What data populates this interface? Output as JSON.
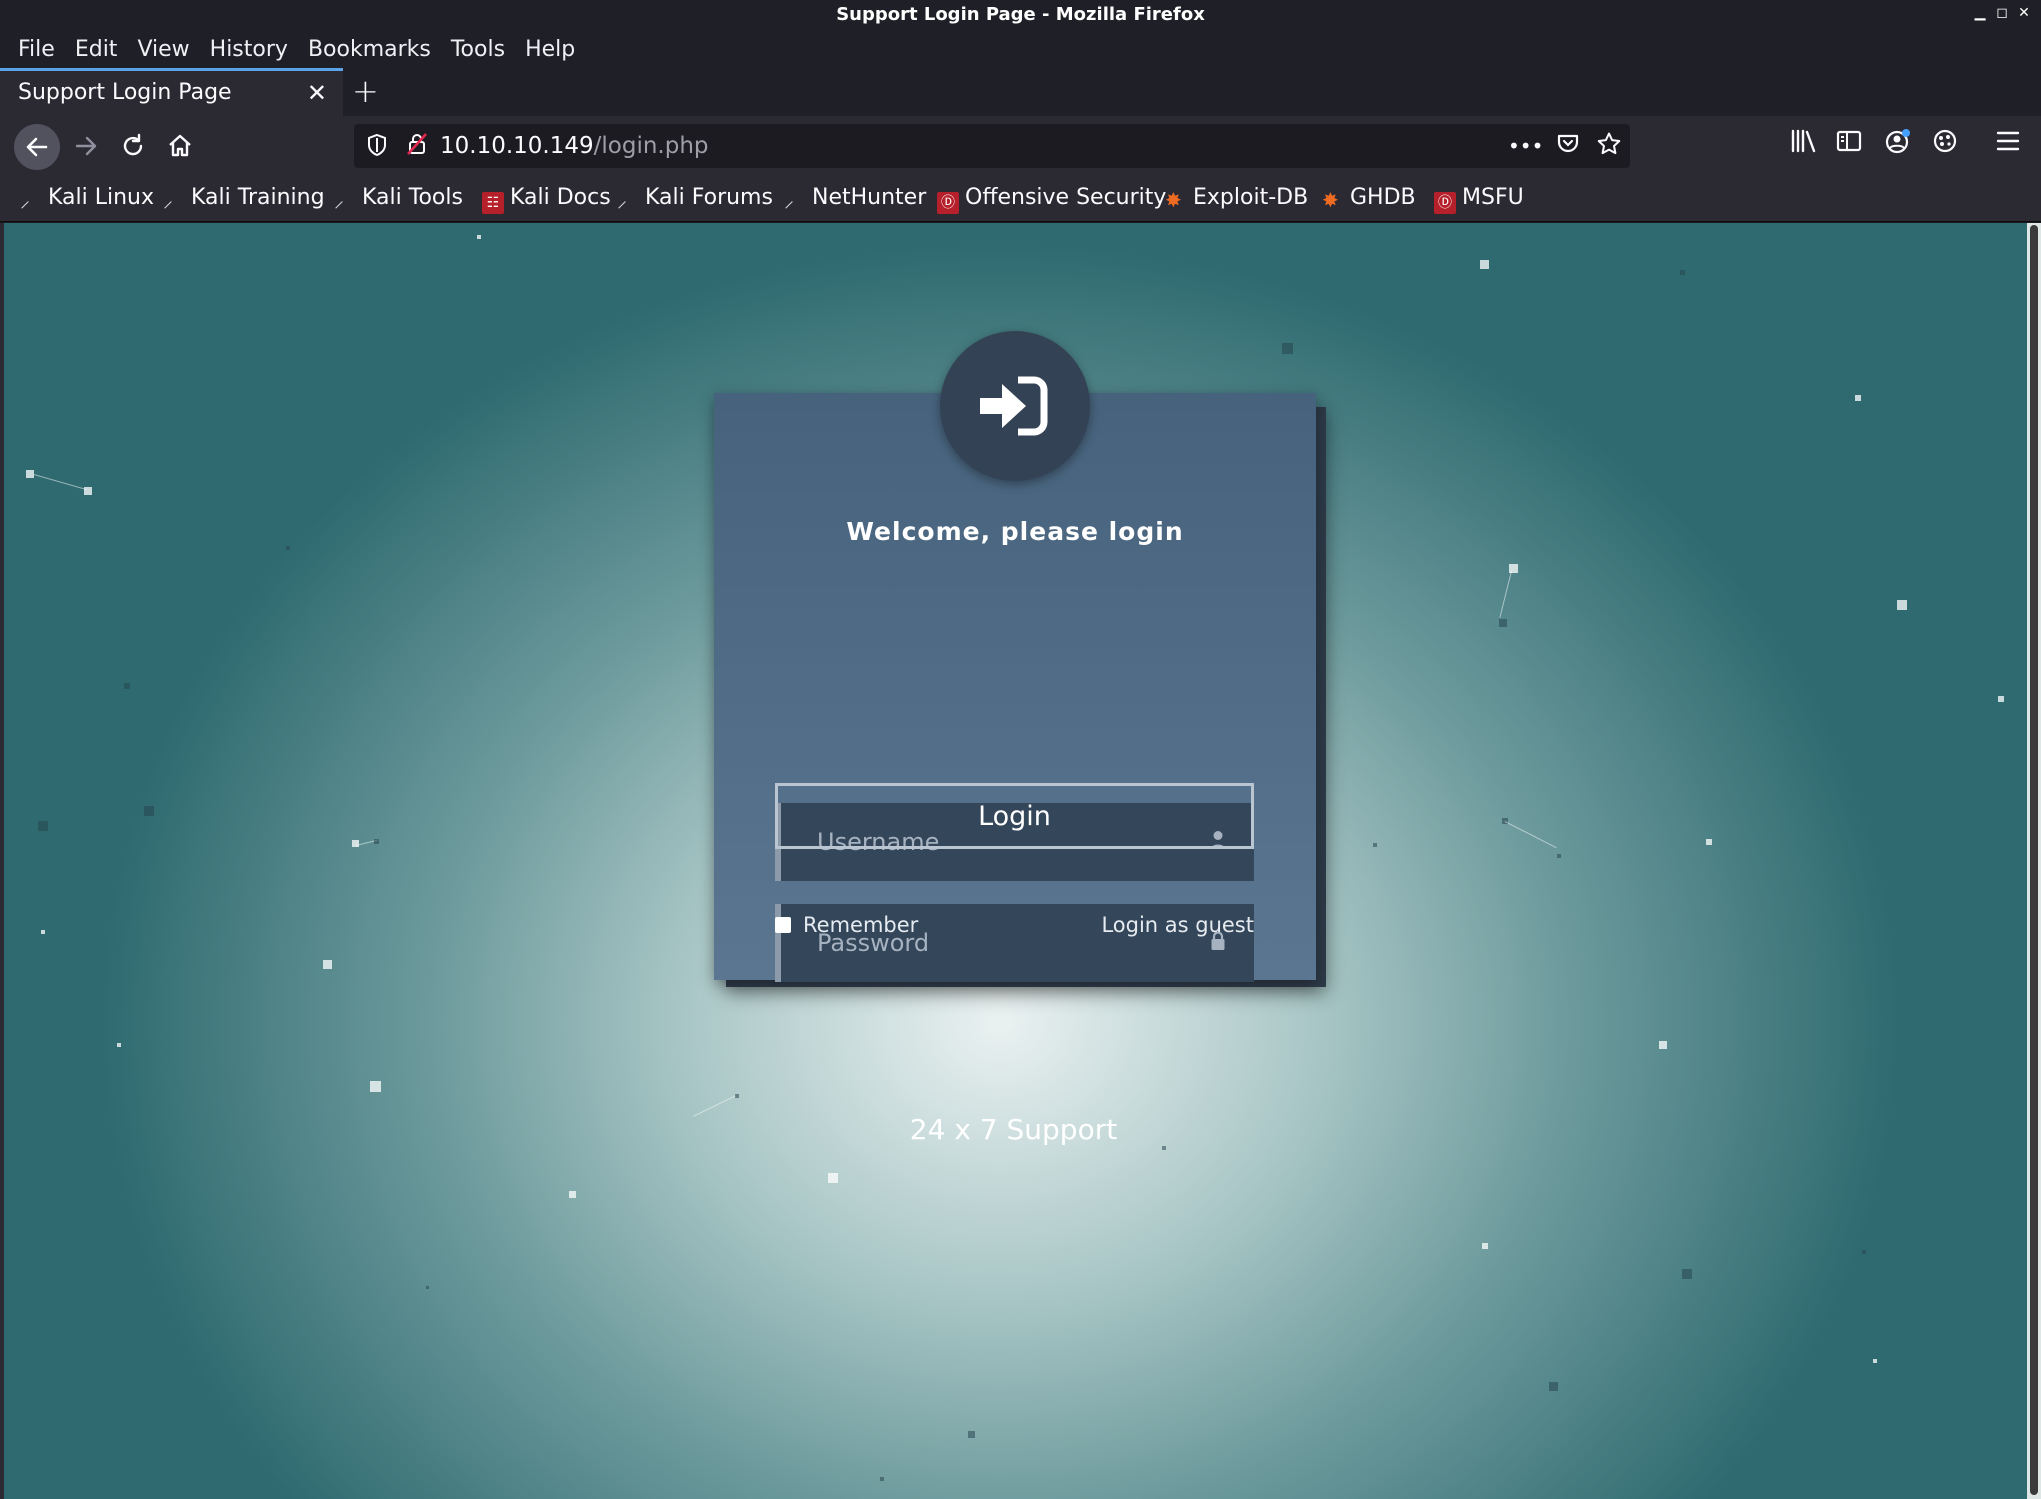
{
  "window": {
    "title": "Support Login Page - Mozilla Firefox",
    "controls": [
      "▁",
      "◻",
      "✕"
    ]
  },
  "menu": {
    "items": [
      "File",
      "Edit",
      "View",
      "History",
      "Bookmarks",
      "Tools",
      "Help"
    ]
  },
  "tab": {
    "title": "Support Login Page",
    "close": "✕",
    "new_tab": "+"
  },
  "nav": {
    "url_host": "10.10.10.149",
    "url_path": "/login.php",
    "more": "•••"
  },
  "bookmarks": [
    {
      "label": "Kali Linux",
      "icon": "kali-dragon-icon"
    },
    {
      "label": "Kali Training",
      "icon": "kali-dragon-icon"
    },
    {
      "label": "Kali Tools",
      "icon": "kali-dragon-icon"
    },
    {
      "label": "Kali Docs",
      "icon": "kali-docs-icon"
    },
    {
      "label": "Kali Forums",
      "icon": "kali-dragon-icon"
    },
    {
      "label": "NetHunter",
      "icon": "kali-dragon-icon"
    },
    {
      "label": "Offensive Security",
      "icon": "offsec-icon"
    },
    {
      "label": "Exploit-DB",
      "icon": "exploitdb-icon"
    },
    {
      "label": "GHDB",
      "icon": "exploitdb-icon"
    },
    {
      "label": "MSFU",
      "icon": "offsec-icon"
    }
  ],
  "login": {
    "heading": "Welcome, please login",
    "username_placeholder": "Username",
    "password_placeholder": "Password",
    "button": "Login",
    "remember": "Remember",
    "guest": "Login as guest"
  },
  "footer": {
    "support": "24 x 7 Support"
  },
  "colors": {
    "accent_tab": "#5aa3e8",
    "card_top": "#46627c",
    "card_bottom": "#5b7690",
    "field_bg": "#34465a"
  }
}
